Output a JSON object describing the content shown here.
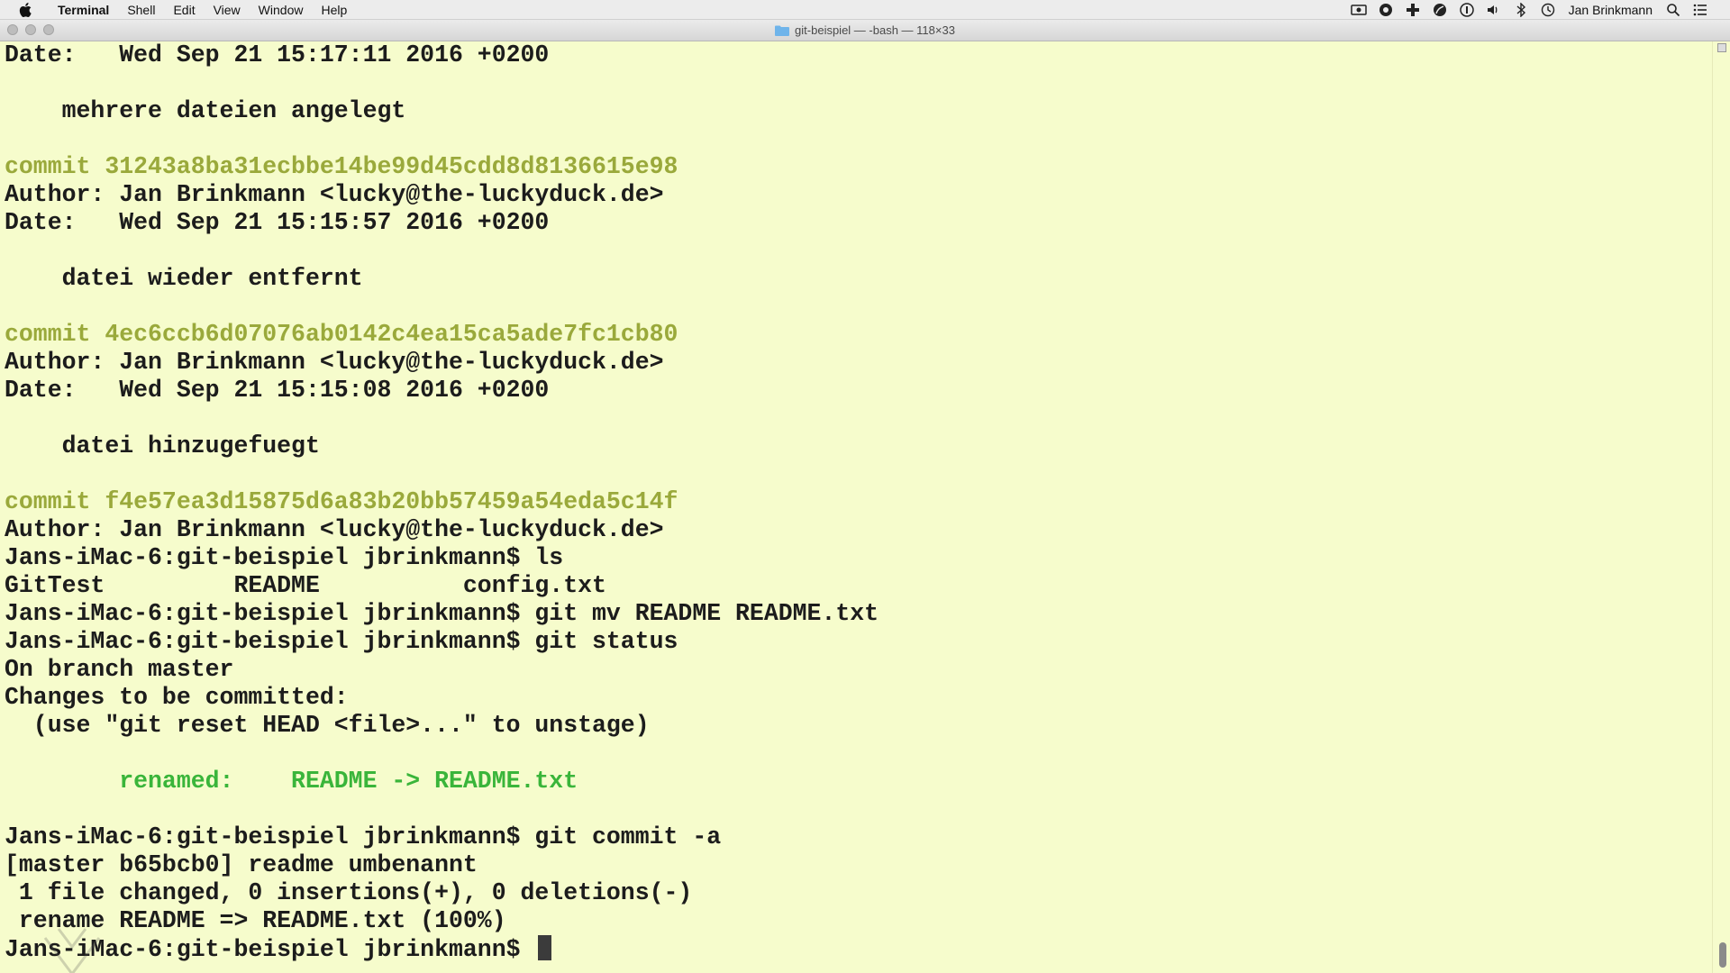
{
  "menubar": {
    "app": "Terminal",
    "items": [
      "Shell",
      "Edit",
      "View",
      "Window",
      "Help"
    ],
    "user": "Jan Brinkmann",
    "status_icons": [
      "screen-record-icon",
      "creative-cloud-icon",
      "plus-cross-icon",
      "leaf-icon",
      "info-icon",
      "volume-icon",
      "bluetooth-icon",
      "time-machine-icon"
    ]
  },
  "window": {
    "title": "git-beispiel — -bash — 118×33"
  },
  "terminal": {
    "lines": [
      {
        "text": "Date:   Wed Sep 21 15:17:11 2016 +0200",
        "type": "normal"
      },
      {
        "text": "",
        "type": "normal"
      },
      {
        "text": "    mehrere dateien angelegt",
        "type": "normal"
      },
      {
        "text": "",
        "type": "normal"
      },
      {
        "text": "commit 31243a8ba31ecbbe14be99d45cdd8d8136615e98",
        "type": "commit"
      },
      {
        "text": "Author: Jan Brinkmann <lucky@the-luckyduck.de>",
        "type": "normal"
      },
      {
        "text": "Date:   Wed Sep 21 15:15:57 2016 +0200",
        "type": "normal"
      },
      {
        "text": "",
        "type": "normal"
      },
      {
        "text": "    datei wieder entfernt",
        "type": "normal"
      },
      {
        "text": "",
        "type": "normal"
      },
      {
        "text": "commit 4ec6ccb6d07076ab0142c4ea15ca5ade7fc1cb80",
        "type": "commit"
      },
      {
        "text": "Author: Jan Brinkmann <lucky@the-luckyduck.de>",
        "type": "normal"
      },
      {
        "text": "Date:   Wed Sep 21 15:15:08 2016 +0200",
        "type": "normal"
      },
      {
        "text": "",
        "type": "normal"
      },
      {
        "text": "    datei hinzugefuegt",
        "type": "normal"
      },
      {
        "text": "",
        "type": "normal"
      },
      {
        "text": "commit f4e57ea3d15875d6a83b20bb57459a54eda5c14f",
        "type": "commit"
      },
      {
        "text": "Author: Jan Brinkmann <lucky@the-luckyduck.de>",
        "type": "normal"
      },
      {
        "text": "Jans-iMac-6:git-beispiel jbrinkmann$ ls",
        "type": "normal"
      },
      {
        "text": "GitTest         README          config.txt",
        "type": "normal"
      },
      {
        "text": "Jans-iMac-6:git-beispiel jbrinkmann$ git mv README README.txt",
        "type": "normal"
      },
      {
        "text": "Jans-iMac-6:git-beispiel jbrinkmann$ git status",
        "type": "normal"
      },
      {
        "text": "On branch master",
        "type": "normal"
      },
      {
        "text": "Changes to be committed:",
        "type": "normal"
      },
      {
        "text": "  (use \"git reset HEAD <file>...\" to unstage)",
        "type": "normal"
      },
      {
        "text": "",
        "type": "normal"
      },
      {
        "text": "        renamed:    README -> README.txt",
        "type": "renamed"
      },
      {
        "text": "",
        "type": "normal"
      },
      {
        "text": "Jans-iMac-6:git-beispiel jbrinkmann$ git commit -a",
        "type": "normal"
      },
      {
        "text": "[master b65bcb0] readme umbenannt",
        "type": "normal"
      },
      {
        "text": " 1 file changed, 0 insertions(+), 0 deletions(-)",
        "type": "normal"
      },
      {
        "text": " rename README => README.txt (100%)",
        "type": "normal"
      },
      {
        "text": "Jans-iMac-6:git-beispiel jbrinkmann$ ",
        "type": "prompt"
      }
    ]
  },
  "colors": {
    "terminal_bg": "#f6fccc",
    "text": "#1c1c1c",
    "commit": "#9aa93b",
    "renamed": "#3ab53a"
  }
}
